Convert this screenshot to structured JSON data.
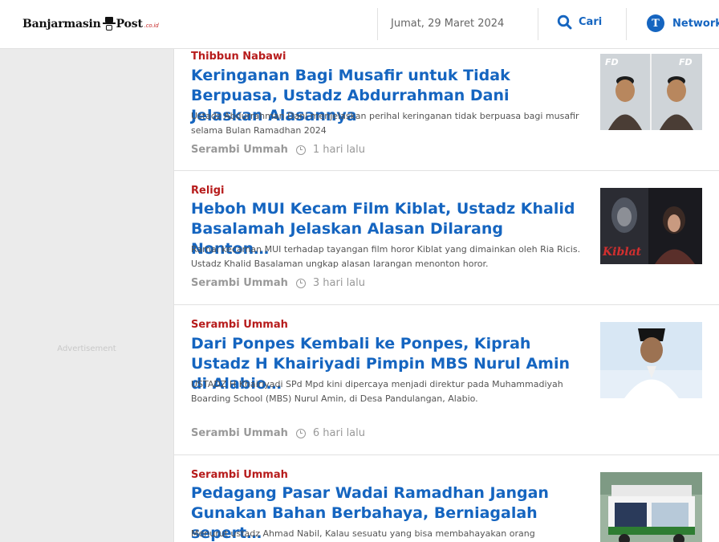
{
  "header": {
    "logo_text": "Banjarmasin",
    "logo_text_2": "Post",
    "logo_suffix": ".co.id",
    "date": "Jumat, 29 Maret 2024",
    "search_label": "Cari",
    "network_label": "Network",
    "network_icon_letter": "T"
  },
  "ad": {
    "label": "Advertisement"
  },
  "articles": [
    {
      "category": "Thibbun Nabawi",
      "title": "Keringanan Bagi Musafir untuk Tidak Berpuasa, Ustadz Abdurrahman Dani Jelaskan Alasannya",
      "summary": "Ustadz Abdurrahman Dani menjelaskan perihal keringanan tidak berpuasa bagi musafir selama Bulan Ramadhan 2024",
      "source": "Serambi Ummah",
      "time": "1 hari lalu",
      "thumb_text_1": "FD",
      "thumb_text_2": "FD"
    },
    {
      "category": "Religi",
      "title": "Heboh MUI Kecam Film Kiblat, Ustadz Khalid Basalamah Jelaskan Alasan Dilarang Nonton…",
      "summary": "Ramai kecaman MUI terhadap tayangan film horor Kiblat yang dimainkan oleh Ria Ricis. Ustadz Khalid Basalaman ungkap alasan larangan menonton horor.",
      "source": "Serambi Ummah",
      "time": "3 hari lalu",
      "thumb_text_1": "Kiblat"
    },
    {
      "category": "Serambi Ummah",
      "title": "Dari Ponpes Kembali ke Ponpes, Kiprah Ustadz H Khairiyadi Pimpin MBS Nurul Amin di Alabio…",
      "summary": "USTADZ H Khairiyadi SPd Mpd kini dipercaya menjadi direktur pada Muhammadiyah Boarding School (MBS) Nurul Amin, di Desa Pandulangan, Alabio.",
      "source": "Serambi Ummah",
      "time": "6 hari lalu"
    },
    {
      "category": "Serambi Ummah",
      "title": "Pedagang Pasar Wadai Ramadhan Jangan Gunakan Bahan Berbahaya, Berniagalah sepert…",
      "summary": "Menurut ustadz Ahmad Nabil, Kalau sesuatu yang bisa membahayakan orang",
      "source": "Serambi Ummah",
      "time": ""
    }
  ],
  "colors": {
    "accent_blue": "#1565c0",
    "category_red": "#b71c1c"
  }
}
